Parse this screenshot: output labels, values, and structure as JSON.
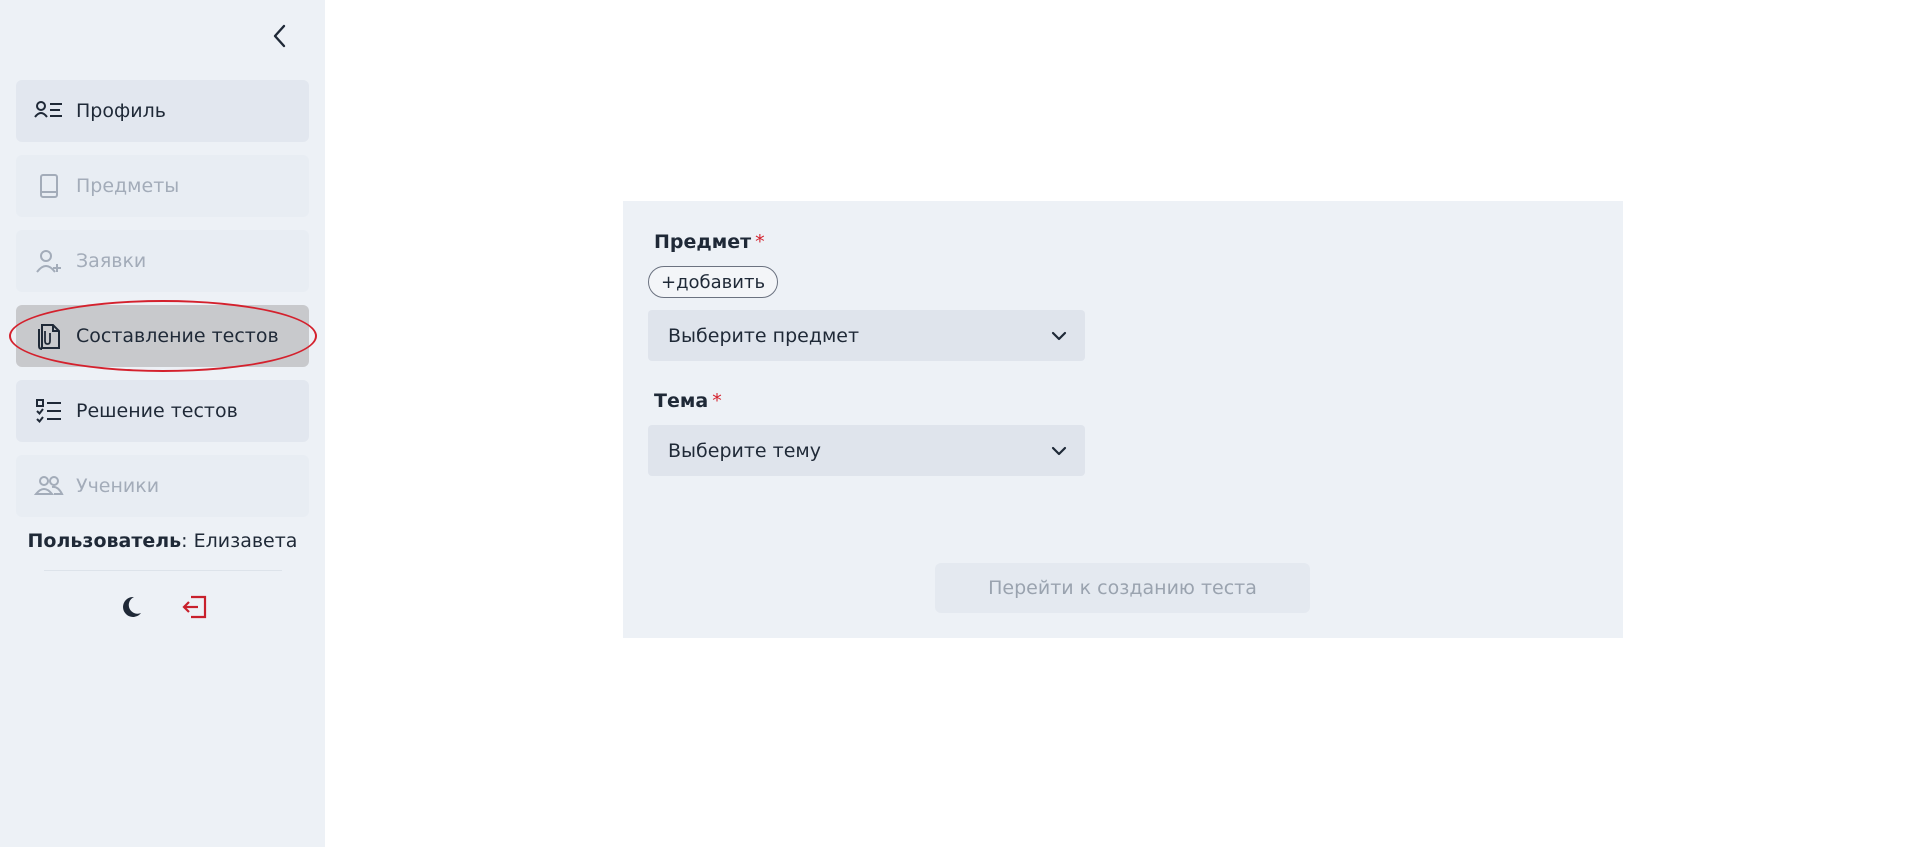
{
  "sidebar": {
    "items": [
      {
        "label": "Профиль",
        "icon": "profile-list-icon",
        "state": "enabled"
      },
      {
        "label": "Предметы",
        "icon": "book-icon",
        "state": "disabled"
      },
      {
        "label": "Заявки",
        "icon": "user-plus-icon",
        "state": "disabled"
      },
      {
        "label": "Составление тестов",
        "icon": "documents-clip-icon",
        "state": "active"
      },
      {
        "label": "Решение тестов",
        "icon": "checklist-icon",
        "state": "enabled"
      },
      {
        "label": "Ученики",
        "icon": "users-icon",
        "state": "disabled"
      }
    ],
    "user_label": "Пользователь",
    "user_name": ": Елизавета"
  },
  "form": {
    "subject_label": "Предмет",
    "required_mark": "*",
    "add_label": "+добавить",
    "subject_placeholder": "Выберите предмет",
    "topic_label": "Тема",
    "topic_placeholder": "Выберите тему",
    "submit_label": "Перейти к созданию теста"
  },
  "colors": {
    "sidebar_bg": "#edf1f6",
    "active_item": "#c8c9cc",
    "required": "#d4212d",
    "logout": "#c8202c",
    "highlight_ring": "#d4212d"
  }
}
